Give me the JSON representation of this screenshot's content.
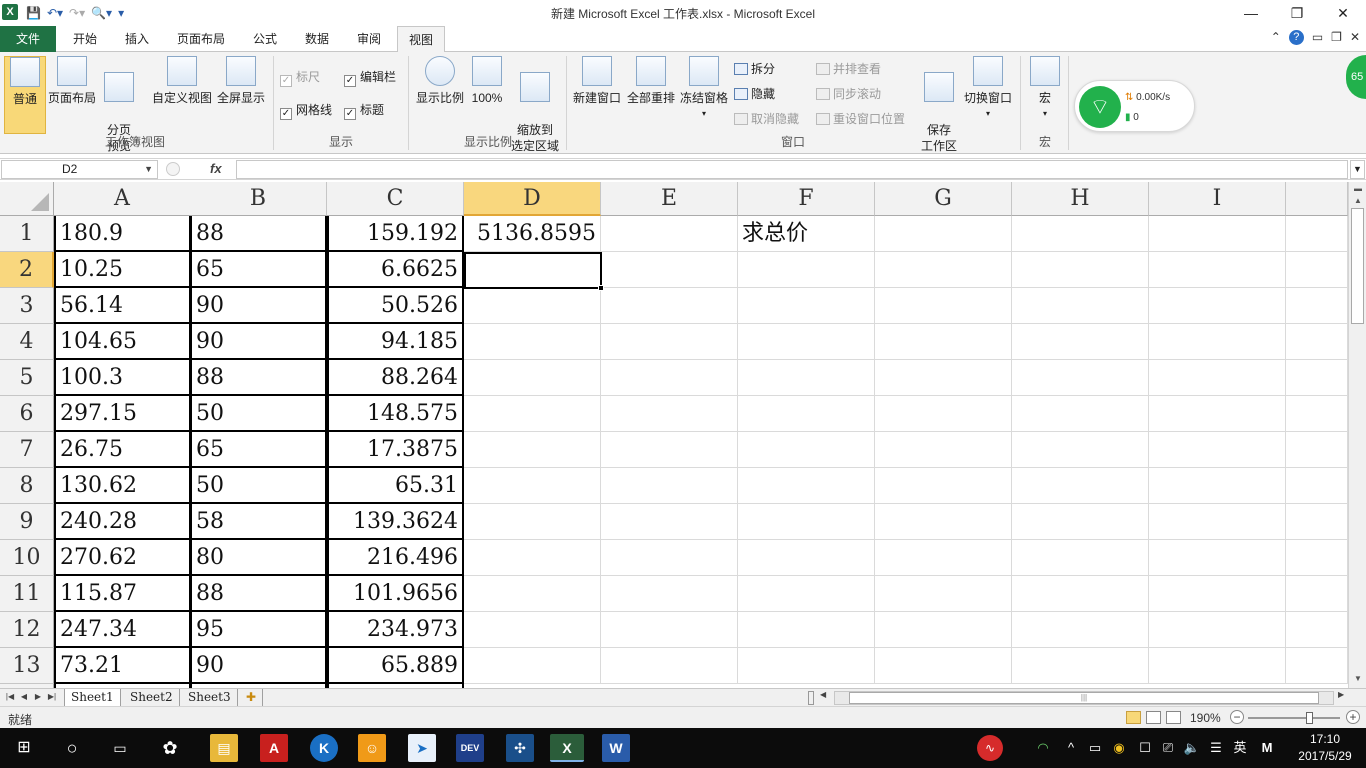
{
  "window": {
    "title": "新建 Microsoft Excel 工作表.xlsx - Microsoft Excel",
    "app_icon": "X",
    "minimize_glyph": "—",
    "restore_glyph": "❐",
    "close_glyph": "✕"
  },
  "ribbon_tabs": [
    "文件",
    "开始",
    "插入",
    "页面布局",
    "公式",
    "数据",
    "审阅",
    "视图"
  ],
  "active_tab": "视图",
  "ribbon": {
    "workbook_views": {
      "label": "工作簿视图",
      "normal": "普通",
      "page_layout": "页面布局",
      "page_break": "分页\n预览",
      "custom_views": "自定义视图",
      "full_screen": "全屏显示"
    },
    "show": {
      "label": "显示",
      "ruler": "标尺",
      "formula_bar": "编辑栏",
      "gridlines": "网格线",
      "headings": "标题"
    },
    "zoom": {
      "label": "显示比例",
      "zoom": "显示比例",
      "hundred": "100%",
      "to_selection": "缩放到\n选定区域"
    },
    "window": {
      "label": "窗口",
      "new_window": "新建窗口",
      "arrange_all": "全部重排",
      "freeze_panes": "冻结窗格",
      "split": "拆分",
      "hide": "隐藏",
      "unhide": "取消隐藏",
      "side_by_side": "并排查看",
      "sync_scroll": "同步滚动",
      "reset_position": "重设窗口位置",
      "save_workspace": "保存\n工作区",
      "switch_windows": "切换窗口"
    },
    "macros": {
      "label": "宏",
      "macros": "宏"
    }
  },
  "net_widget": {
    "speed": "0.00K/s",
    "count": "0"
  },
  "ball_badge": "65",
  "formula_bar": {
    "name_box": "D2",
    "fx": "fx",
    "formula": ""
  },
  "columns": [
    "A",
    "B",
    "C",
    "D",
    "E",
    "F",
    "G",
    "H",
    "I"
  ],
  "selected_column": "D",
  "rows": [
    {
      "n": "1",
      "a": "180.9",
      "b": "88",
      "c": "159.192",
      "d": "5136.8595",
      "f": "求总价"
    },
    {
      "n": "2",
      "a": "10.25",
      "b": "65",
      "c": "6.6625",
      "d": "",
      "f": ""
    },
    {
      "n": "3",
      "a": "56.14",
      "b": "90",
      "c": "50.526",
      "d": "",
      "f": ""
    },
    {
      "n": "4",
      "a": "104.65",
      "b": "90",
      "c": "94.185",
      "d": "",
      "f": ""
    },
    {
      "n": "5",
      "a": "100.3",
      "b": "88",
      "c": "88.264",
      "d": "",
      "f": ""
    },
    {
      "n": "6",
      "a": "297.15",
      "b": "50",
      "c": "148.575",
      "d": "",
      "f": ""
    },
    {
      "n": "7",
      "a": "26.75",
      "b": "65",
      "c": "17.3875",
      "d": "",
      "f": ""
    },
    {
      "n": "8",
      "a": "130.62",
      "b": "50",
      "c": "65.31",
      "d": "",
      "f": ""
    },
    {
      "n": "9",
      "a": "240.28",
      "b": "58",
      "c": "139.3624",
      "d": "",
      "f": ""
    },
    {
      "n": "10",
      "a": "270.62",
      "b": "80",
      "c": "216.496",
      "d": "",
      "f": ""
    },
    {
      "n": "11",
      "a": "115.87",
      "b": "88",
      "c": "101.9656",
      "d": "",
      "f": ""
    },
    {
      "n": "12",
      "a": "247.34",
      "b": "95",
      "c": "234.973",
      "d": "",
      "f": ""
    },
    {
      "n": "13",
      "a": "73.21",
      "b": "90",
      "c": "65.889",
      "d": "",
      "f": ""
    }
  ],
  "selected_row": "2",
  "sheets": [
    "Sheet1",
    "Sheet2",
    "Sheet3"
  ],
  "active_sheet": "Sheet1",
  "status": {
    "ready": "就绪",
    "zoom": "190%"
  },
  "taskbar": {
    "time": "17:10",
    "date": "2017/5/29",
    "ime": "英",
    "ime2": "M"
  },
  "colors": {
    "excel_green": "#1f7244",
    "selection_header": "#f9d77e"
  }
}
